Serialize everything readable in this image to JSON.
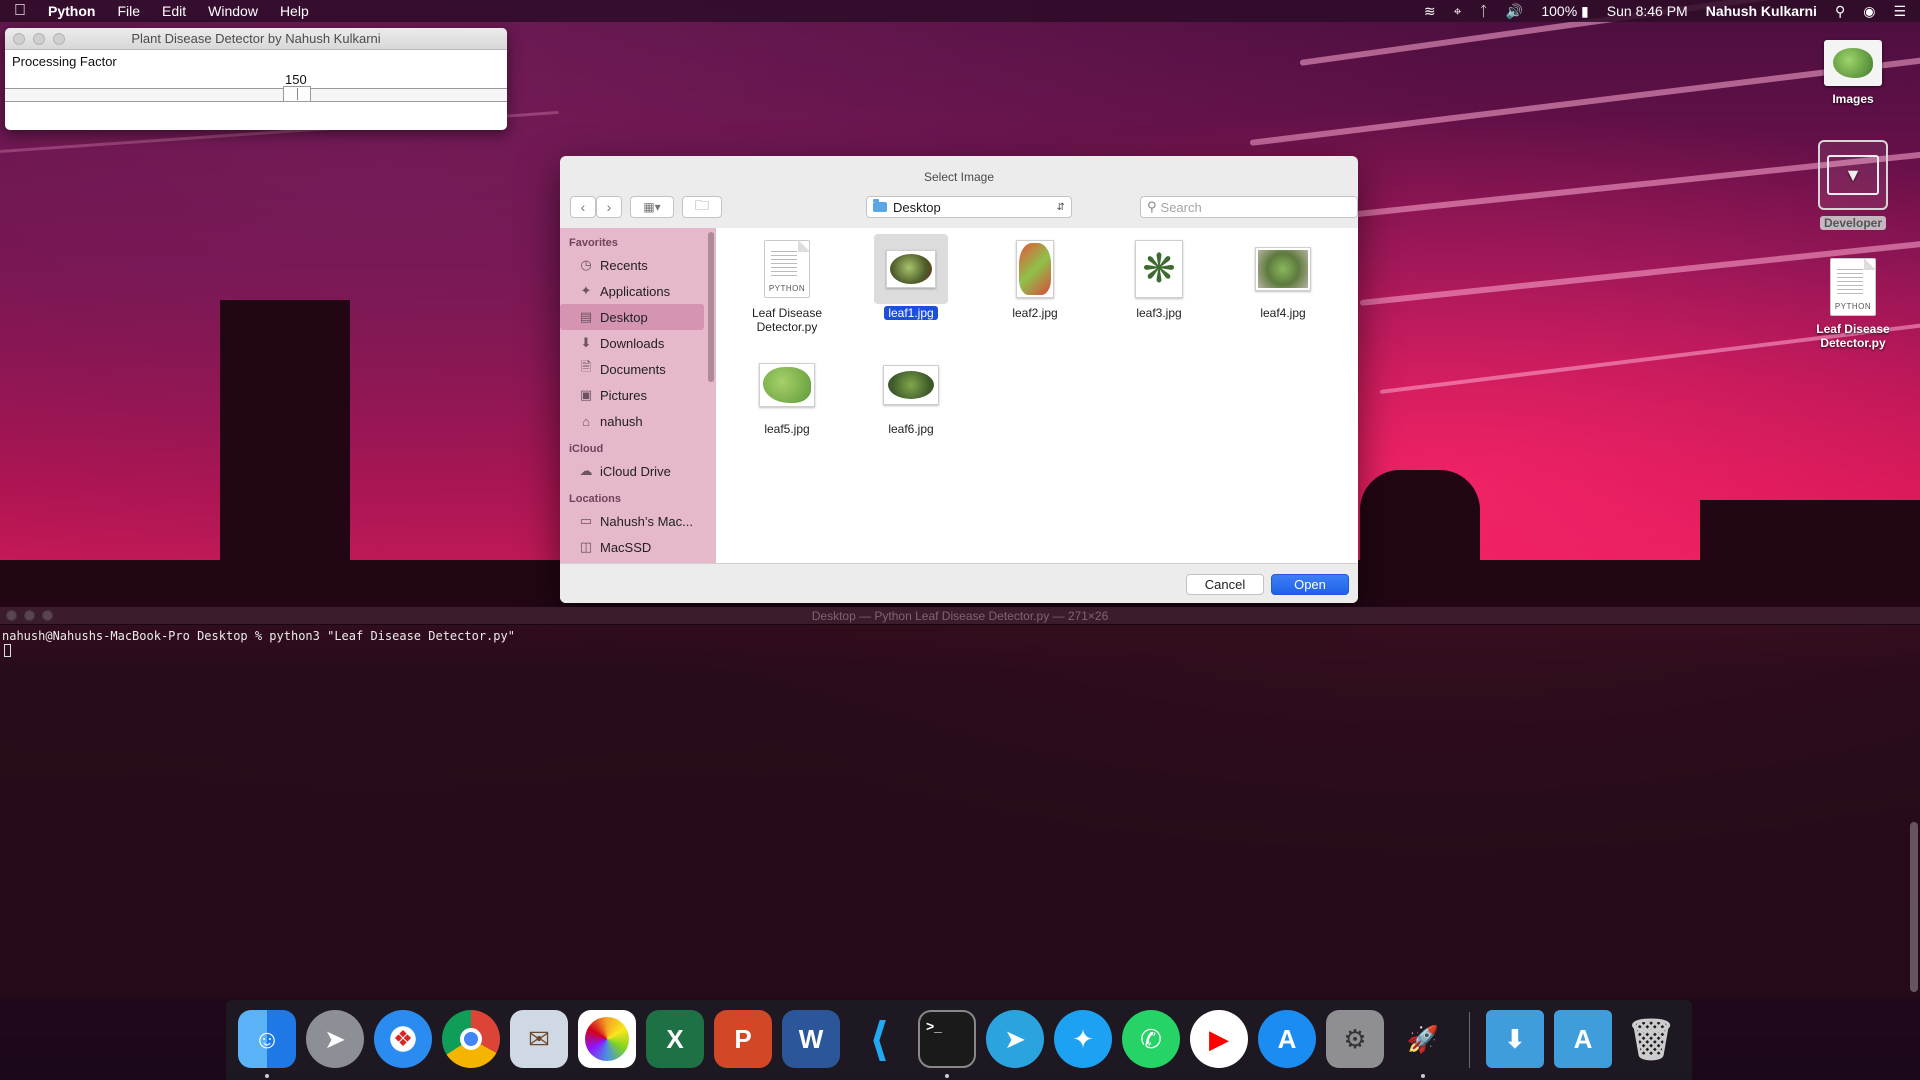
{
  "menubar": {
    "app_name": "Python",
    "menus": [
      "File",
      "Edit",
      "Window",
      "Help"
    ],
    "battery": "100%",
    "clock": "Sun 8:46 PM",
    "user": "Nahush Kulkarni"
  },
  "tk_window": {
    "title": "Plant Disease Detector by Nahush Kulkarni",
    "label": "Processing Factor",
    "value": "150"
  },
  "desktop_icons": {
    "images": "Images",
    "developer": "Developer",
    "python_file_line1": "Leaf Disease",
    "python_file_line2": "Detector.py",
    "python_tag": "PYTHON"
  },
  "dialog": {
    "title": "Select Image",
    "location": "Desktop",
    "search_placeholder": "Search",
    "sidebar": {
      "favorites_header": "Favorites",
      "favorites": [
        "Recents",
        "Applications",
        "Desktop",
        "Downloads",
        "Documents",
        "Pictures",
        "nahush"
      ],
      "icloud_header": "iCloud",
      "icloud": [
        "iCloud Drive"
      ],
      "locations_header": "Locations",
      "locations": [
        "Nahush’s Mac...",
        "MacSSD"
      ]
    },
    "files": [
      {
        "name_line1": "Leaf Disease",
        "name_line2": "Detector.py",
        "tag": "PYTHON"
      },
      {
        "name": "leaf1.jpg"
      },
      {
        "name": "leaf2.jpg"
      },
      {
        "name": "leaf3.jpg"
      },
      {
        "name": "leaf4.jpg"
      },
      {
        "name": "leaf5.jpg"
      },
      {
        "name": "leaf6.jpg"
      }
    ],
    "cancel_label": "Cancel",
    "open_label": "Open"
  },
  "terminal": {
    "title": "Desktop — Python Leaf Disease Detector.py — 271×26",
    "command": "nahush@Nahushs-MacBook-Pro Desktop % python3 \"Leaf Disease Detector.py\""
  },
  "dock": {
    "apps": [
      "finder-icon",
      "launchpad-icon",
      "safari-icon",
      "chrome-icon",
      "mail-icon",
      "photos-icon",
      "excel-icon",
      "powerpoint-icon",
      "word-icon",
      "vscode-icon",
      "terminal-icon",
      "telegram-icon",
      "twitter-icon",
      "whatsapp-icon",
      "youtube-icon",
      "app-store-icon",
      "system-preferences-icon",
      "python-launcher-icon",
      "downloads-folder-icon",
      "applications-folder-icon",
      "trash-icon"
    ]
  },
  "colors": {
    "accent_blue": "#1b4fdc",
    "sidebar_pink": "#e6b8cc",
    "open_button": "#2a6cf0"
  }
}
